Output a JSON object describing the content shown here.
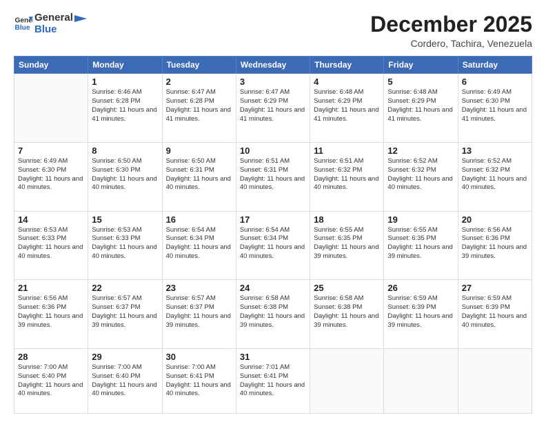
{
  "header": {
    "logo": {
      "line1": "General",
      "line2": "Blue"
    },
    "title": "December 2025",
    "location": "Cordero, Tachira, Venezuela"
  },
  "days_of_week": [
    "Sunday",
    "Monday",
    "Tuesday",
    "Wednesday",
    "Thursday",
    "Friday",
    "Saturday"
  ],
  "weeks": [
    [
      {
        "num": "",
        "info": ""
      },
      {
        "num": "1",
        "info": "Sunrise: 6:46 AM\nSunset: 6:28 PM\nDaylight: 11 hours\nand 41 minutes."
      },
      {
        "num": "2",
        "info": "Sunrise: 6:47 AM\nSunset: 6:28 PM\nDaylight: 11 hours\nand 41 minutes."
      },
      {
        "num": "3",
        "info": "Sunrise: 6:47 AM\nSunset: 6:29 PM\nDaylight: 11 hours\nand 41 minutes."
      },
      {
        "num": "4",
        "info": "Sunrise: 6:48 AM\nSunset: 6:29 PM\nDaylight: 11 hours\nand 41 minutes."
      },
      {
        "num": "5",
        "info": "Sunrise: 6:48 AM\nSunset: 6:29 PM\nDaylight: 11 hours\nand 41 minutes."
      },
      {
        "num": "6",
        "info": "Sunrise: 6:49 AM\nSunset: 6:30 PM\nDaylight: 11 hours\nand 41 minutes."
      }
    ],
    [
      {
        "num": "7",
        "info": "Sunrise: 6:49 AM\nSunset: 6:30 PM\nDaylight: 11 hours\nand 40 minutes."
      },
      {
        "num": "8",
        "info": "Sunrise: 6:50 AM\nSunset: 6:30 PM\nDaylight: 11 hours\nand 40 minutes."
      },
      {
        "num": "9",
        "info": "Sunrise: 6:50 AM\nSunset: 6:31 PM\nDaylight: 11 hours\nand 40 minutes."
      },
      {
        "num": "10",
        "info": "Sunrise: 6:51 AM\nSunset: 6:31 PM\nDaylight: 11 hours\nand 40 minutes."
      },
      {
        "num": "11",
        "info": "Sunrise: 6:51 AM\nSunset: 6:32 PM\nDaylight: 11 hours\nand 40 minutes."
      },
      {
        "num": "12",
        "info": "Sunrise: 6:52 AM\nSunset: 6:32 PM\nDaylight: 11 hours\nand 40 minutes."
      },
      {
        "num": "13",
        "info": "Sunrise: 6:52 AM\nSunset: 6:32 PM\nDaylight: 11 hours\nand 40 minutes."
      }
    ],
    [
      {
        "num": "14",
        "info": "Sunrise: 6:53 AM\nSunset: 6:33 PM\nDaylight: 11 hours\nand 40 minutes."
      },
      {
        "num": "15",
        "info": "Sunrise: 6:53 AM\nSunset: 6:33 PM\nDaylight: 11 hours\nand 40 minutes."
      },
      {
        "num": "16",
        "info": "Sunrise: 6:54 AM\nSunset: 6:34 PM\nDaylight: 11 hours\nand 40 minutes."
      },
      {
        "num": "17",
        "info": "Sunrise: 6:54 AM\nSunset: 6:34 PM\nDaylight: 11 hours\nand 40 minutes."
      },
      {
        "num": "18",
        "info": "Sunrise: 6:55 AM\nSunset: 6:35 PM\nDaylight: 11 hours\nand 39 minutes."
      },
      {
        "num": "19",
        "info": "Sunrise: 6:55 AM\nSunset: 6:35 PM\nDaylight: 11 hours\nand 39 minutes."
      },
      {
        "num": "20",
        "info": "Sunrise: 6:56 AM\nSunset: 6:36 PM\nDaylight: 11 hours\nand 39 minutes."
      }
    ],
    [
      {
        "num": "21",
        "info": "Sunrise: 6:56 AM\nSunset: 6:36 PM\nDaylight: 11 hours\nand 39 minutes."
      },
      {
        "num": "22",
        "info": "Sunrise: 6:57 AM\nSunset: 6:37 PM\nDaylight: 11 hours\nand 39 minutes."
      },
      {
        "num": "23",
        "info": "Sunrise: 6:57 AM\nSunset: 6:37 PM\nDaylight: 11 hours\nand 39 minutes."
      },
      {
        "num": "24",
        "info": "Sunrise: 6:58 AM\nSunset: 6:38 PM\nDaylight: 11 hours\nand 39 minutes."
      },
      {
        "num": "25",
        "info": "Sunrise: 6:58 AM\nSunset: 6:38 PM\nDaylight: 11 hours\nand 39 minutes."
      },
      {
        "num": "26",
        "info": "Sunrise: 6:59 AM\nSunset: 6:39 PM\nDaylight: 11 hours\nand 39 minutes."
      },
      {
        "num": "27",
        "info": "Sunrise: 6:59 AM\nSunset: 6:39 PM\nDaylight: 11 hours\nand 40 minutes."
      }
    ],
    [
      {
        "num": "28",
        "info": "Sunrise: 7:00 AM\nSunset: 6:40 PM\nDaylight: 11 hours\nand 40 minutes."
      },
      {
        "num": "29",
        "info": "Sunrise: 7:00 AM\nSunset: 6:40 PM\nDaylight: 11 hours\nand 40 minutes."
      },
      {
        "num": "30",
        "info": "Sunrise: 7:00 AM\nSunset: 6:41 PM\nDaylight: 11 hours\nand 40 minutes."
      },
      {
        "num": "31",
        "info": "Sunrise: 7:01 AM\nSunset: 6:41 PM\nDaylight: 11 hours\nand 40 minutes."
      },
      {
        "num": "",
        "info": ""
      },
      {
        "num": "",
        "info": ""
      },
      {
        "num": "",
        "info": ""
      }
    ]
  ]
}
